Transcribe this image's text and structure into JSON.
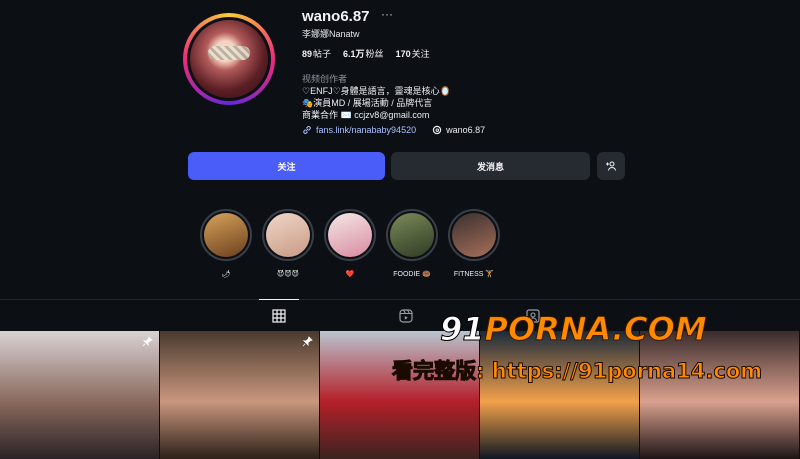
{
  "profile": {
    "username": "wano6.87",
    "more_glyph": "···",
    "full_name": "李娜娜Nanatw",
    "stats": {
      "posts_count": "89",
      "posts_label": "帖子",
      "followers_count": "6.1万",
      "followers_label": "粉丝",
      "following_count": "170",
      "following_label": "关注"
    },
    "category": "视频创作者",
    "bio": "♡ENFJ♡身體是語言，靈魂是核心🪞\n🎭演員MD / 展場活動 / 品牌代言\n商業合作 ✉️ ccjzv8@gmail.com",
    "link_text": "fans.link/nanababy94520",
    "threads_handle": "wano6.87"
  },
  "actions": {
    "follow_label": "关注",
    "message_label": "发消息"
  },
  "highlights": [
    {
      "label": "🌶",
      "colors": [
        "#d7a35c",
        "#6b3f1d"
      ]
    },
    {
      "label": "😈😈😈",
      "colors": [
        "#f0d6c8",
        "#c89a85"
      ]
    },
    {
      "label": "❤️",
      "colors": [
        "#f4e8e6",
        "#d98aa0"
      ]
    },
    {
      "label": "FOODIE 🍩",
      "colors": [
        "#7c8a5a",
        "#2e3b24"
      ]
    },
    {
      "label": "FITNESS 🏋",
      "colors": [
        "#3a3030",
        "#a86f5a"
      ]
    }
  ],
  "tabs": [
    {
      "name": "posts",
      "icon": "grid-icon",
      "active": true
    },
    {
      "name": "reels",
      "icon": "reels-icon",
      "active": false
    },
    {
      "name": "tagged",
      "icon": "tagged-icon",
      "active": false
    }
  ],
  "posts": [
    {
      "colors": [
        "#d9d2d4",
        "#8a6a5e",
        "#2a2326"
      ],
      "pinned": true
    },
    {
      "colors": [
        "#4a3a2e",
        "#c9977d",
        "#2c2118"
      ],
      "pinned": true
    },
    {
      "colors": [
        "#b9c4cf",
        "#b4202a",
        "#3b2320"
      ],
      "pinned": false
    },
    {
      "colors": [
        "#1a2a3c",
        "#f3a14a",
        "#0f1722"
      ],
      "pinned": false
    },
    {
      "colors": [
        "#3a2b2c",
        "#d9a08e",
        "#1d1415"
      ],
      "pinned": false
    }
  ],
  "watermark": {
    "domain_a": "91",
    "domain_b": "PORNA.COM",
    "promo": "看完整版: https://91porna14.com",
    "orange": "#ff8a00"
  }
}
